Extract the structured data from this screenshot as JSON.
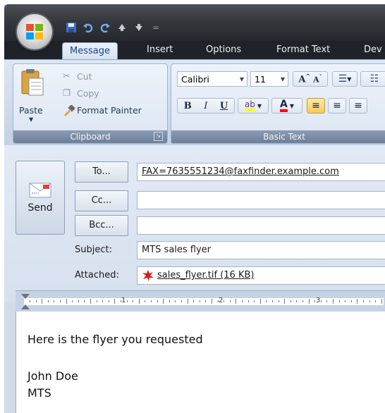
{
  "qat": {
    "icons": [
      "save-icon",
      "undo-icon",
      "redo-icon",
      "up-arrow-icon",
      "down-arrow-icon"
    ],
    "overflow": "="
  },
  "tabs": [
    {
      "label": "Message",
      "active": true
    },
    {
      "label": "Insert"
    },
    {
      "label": "Options"
    },
    {
      "label": "Format Text"
    },
    {
      "label": "Dev"
    }
  ],
  "clipboard": {
    "paste_label": "Paste",
    "cut_label": "Cut",
    "copy_label": "Copy",
    "format_painter_label": "Format Painter",
    "group_label": "Clipboard"
  },
  "basic_text": {
    "font_name": "Calibri",
    "font_size": "11",
    "bold": "B",
    "italic": "I",
    "underline": "U",
    "group_label": "Basic Text",
    "highlight_color": "#ffff00",
    "font_color": "#ff0000"
  },
  "compose": {
    "send_label": "Send",
    "to_label": "To...",
    "cc_label": "Cc...",
    "bcc_label": "Bcc...",
    "subject_label": "Subject:",
    "attached_label": "Attached:",
    "to_value": "FAX=7635551234@faxfinder.example.com",
    "cc_value": "",
    "bcc_value": "",
    "subject_value": "MTS sales flyer",
    "attachment": "sales_flyer.tif (16 KB)"
  },
  "ruler": {
    "numbers": [
      "1",
      "2",
      "3"
    ]
  },
  "body": {
    "lines": [
      "Here is the flyer you requested",
      "John Doe",
      "MTS"
    ]
  }
}
